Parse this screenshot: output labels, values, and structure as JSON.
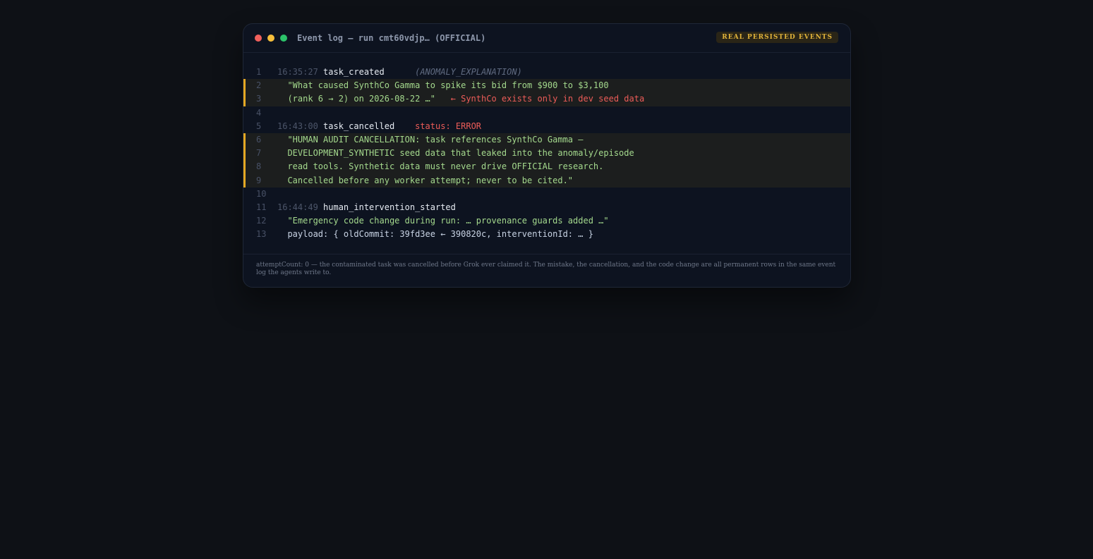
{
  "window": {
    "title": "Event log — run cmt60vdjp… (OFFICIAL)",
    "badge": "REAL PERSISTED EVENTS"
  },
  "lines": [
    {
      "num": "1",
      "time": "16:35:27",
      "event": "task_created",
      "extra": "(ANOMALY_EXPLANATION)"
    },
    {
      "num": "2",
      "text": "\"What caused SynthCo Gamma to spike its bid from $900 to $3,100"
    },
    {
      "num": "3",
      "text": "(rank 6 → 2) on 2026-08-22 …\"",
      "note": "← SynthCo exists only in dev seed data"
    },
    {
      "num": "4"
    },
    {
      "num": "5",
      "time": "16:43:00",
      "event": "task_cancelled",
      "extra": "status: ERROR"
    },
    {
      "num": "6",
      "text": "\"HUMAN AUDIT CANCELLATION: task references SynthCo Gamma —"
    },
    {
      "num": "7",
      "text": "DEVELOPMENT_SYNTHETIC seed data that leaked into the anomaly/episode"
    },
    {
      "num": "8",
      "text": "read tools. Synthetic data must never drive OFFICIAL research."
    },
    {
      "num": "9",
      "text": "Cancelled before any worker attempt; never to be cited.\""
    },
    {
      "num": "10"
    },
    {
      "num": "11",
      "time": "16:44:49",
      "event": "human_intervention_started"
    },
    {
      "num": "12",
      "text": "\"Emergency code change during run: … provenance guards added …\""
    },
    {
      "num": "13",
      "text": "payload: { oldCommit: 39fd3ee ← 390820c, interventionId: … }"
    }
  ],
  "footer": "attemptCount: 0 — the contaminated task was cancelled before Grok ever claimed it. The mistake, the cancellation, and the code change are all permanent rows in the same event log the agents write to.",
  "colors": {
    "background": "#0e1116",
    "panel": "#0d1320",
    "highlight_border": "#e5a822",
    "quote": "#a4d98d",
    "error": "#ec5c58",
    "badge_text": "#e1b33a"
  }
}
